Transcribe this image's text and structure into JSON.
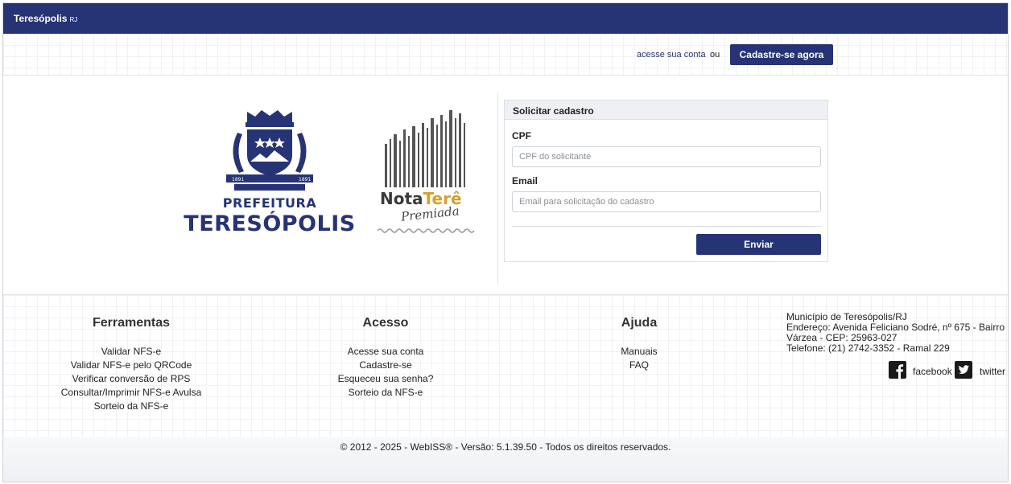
{
  "header": {
    "city": "Teresópolis",
    "state": "RJ"
  },
  "account": {
    "login_link": "acesse sua conta",
    "or_text": "ou",
    "signup_button": "Cadastre-se agora"
  },
  "form": {
    "title": "Solicitar cadastro",
    "cpf_label": "CPF",
    "cpf_placeholder": "CPF do solicitante",
    "email_label": "Email",
    "email_placeholder": "Email para solicitação do cadastro",
    "submit": "Enviar"
  },
  "logos": {
    "prefeitura_line1": "PREFEITURA",
    "prefeitura_line2": "TERESÓPOLIS",
    "nota_part1": "Nota",
    "nota_part2": "Terê",
    "nota_part3": "Premiada"
  },
  "footer": {
    "ferramentas": {
      "title": "Ferramentas",
      "links": [
        "Validar NFS-e",
        "Validar NFS-e pelo QRCode",
        "Verificar conversão de RPS",
        "Consultar/Imprimir NFS-e Avulsa",
        "Sorteio da NFS-e"
      ]
    },
    "acesso": {
      "title": "Acesso",
      "links": [
        "Acesse sua conta",
        "Cadastre-se",
        "Esqueceu sua senha?",
        "Sorteio da NFS-e"
      ]
    },
    "ajuda": {
      "title": "Ajuda",
      "links": [
        "Manuais",
        "FAQ"
      ]
    },
    "contact": {
      "line1": "Município de Teresópolis/RJ",
      "line2": "Endereço: Avenida Feliciano Sodré, nº 675 - Bairro",
      "line3": "Várzea - CEP: 25963-027",
      "line4": "Telefone: (21) 2742-3352 - Ramal 229"
    },
    "social": {
      "facebook": "facebook",
      "twitter": "twitter"
    }
  },
  "copyright": "© 2012 - 2025 - WebISS® - Versão: 5.1.39.50 - Todos os direitos reservados.",
  "colors": {
    "brand_navy": "#263476",
    "nota_gold": "#d6a12b"
  },
  "icons": [
    "coat-of-arms-icon",
    "nota-barcode-icon",
    "facebook-icon",
    "twitter-icon"
  ]
}
